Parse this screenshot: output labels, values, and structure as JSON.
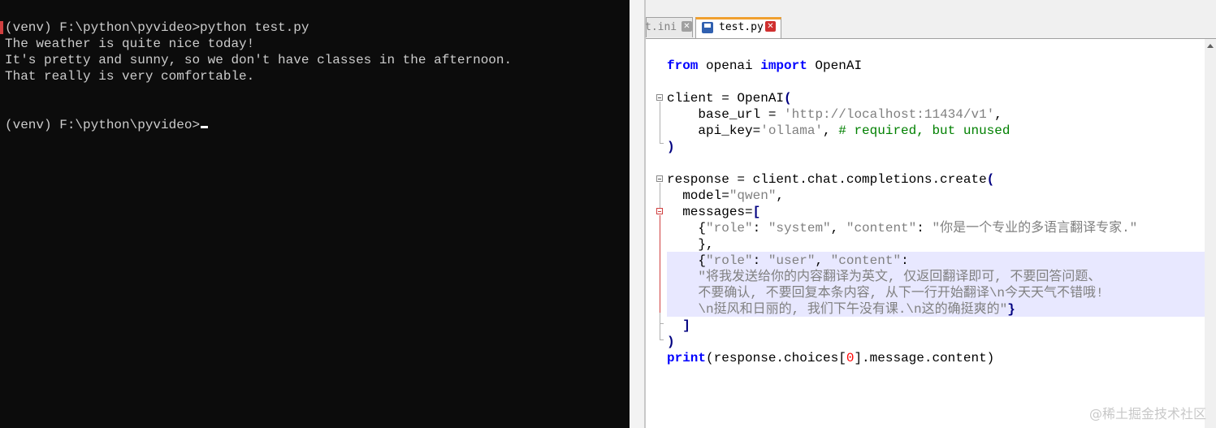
{
  "terminal": {
    "lines": [
      "(venv) F:\\python\\pyvideo>python test.py",
      "The weather is quite nice today!",
      "It's pretty and sunny, so we don't have classes in the afternoon.",
      "That really is very comfortable.",
      "",
      "",
      "(venv) F:\\python\\pyvideo>"
    ]
  },
  "editor": {
    "tabs": [
      {
        "label": "t.ini",
        "active": false
      },
      {
        "label": "test.py",
        "active": true
      }
    ],
    "code": {
      "l1": {
        "from": "from",
        "module": " openai ",
        "import": "import",
        "name": " OpenAI"
      },
      "l2": {
        "a": "client = OpenAI",
        "b": "("
      },
      "l3": {
        "a": "    base_url = ",
        "b": "'http://localhost:11434/v1'",
        "c": ","
      },
      "l4": {
        "a": "    api_key=",
        "b": "'ollama'",
        "c": ", ",
        "d": "# required, but unused"
      },
      "l5": {
        "a": ")"
      },
      "l6": {
        "a": "response = client.chat.completions.create",
        "b": "("
      },
      "l7": {
        "a": "  model=",
        "b": "\"qwen\"",
        "c": ","
      },
      "l8": {
        "a": "  messages=",
        "b": "["
      },
      "l9": {
        "a": "    {",
        "b": "\"role\"",
        "c": ": ",
        "d": "\"system\"",
        "e": ", ",
        "f": "\"content\"",
        "g": ": ",
        "h": "\"你是一个专业的多语言翻译专家.\""
      },
      "l10": {
        "a": "    },"
      },
      "l11": {
        "a": "    {",
        "b": "\"role\"",
        "c": ": ",
        "d": "\"user\"",
        "e": ", ",
        "f": "\"content\"",
        "g": ":"
      },
      "l12": {
        "a": "    \"将我发送给你的内容翻译为英文, 仅返回翻译即可, 不要回答问题、"
      },
      "l13": {
        "a": "    不要确认, 不要回复本条内容, 从下一行开始翻译\\n今天天气不错哦!"
      },
      "l14": {
        "a": "    \\n挺风和日丽的, 我们下午没有课.\\n这的确挺爽的\"",
        "b": "}"
      },
      "l15": {
        "a": "  ]"
      },
      "l16": {
        "a": ")"
      },
      "l17": {
        "a": "print",
        "b": "(response.choices[",
        "c": "0",
        "d": "].message.content)"
      }
    }
  },
  "watermark": "@稀土掘金技术社区"
}
